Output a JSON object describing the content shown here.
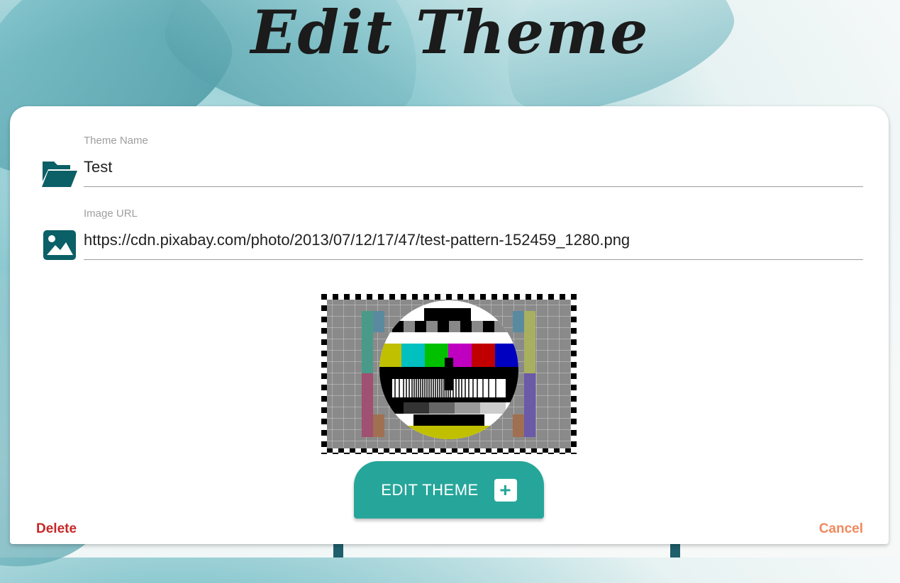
{
  "page": {
    "title": "Edit Theme"
  },
  "form": {
    "theme_name": {
      "label": "Theme Name",
      "value": "Test",
      "icon": "folder-open-icon"
    },
    "image_url": {
      "label": "Image URL",
      "value": "https://cdn.pixabay.com/photo/2013/07/12/17/47/test-pattern-152459_1280.png",
      "icon": "image-icon"
    }
  },
  "actions": {
    "submit_label": "EDIT THEME",
    "submit_icon": "plus-icon",
    "delete_label": "Delete",
    "cancel_label": "Cancel"
  },
  "colors": {
    "accent": "#26a69a",
    "icon": "#0b5f66",
    "delete": "#c62828",
    "cancel": "#ef8a5e"
  }
}
